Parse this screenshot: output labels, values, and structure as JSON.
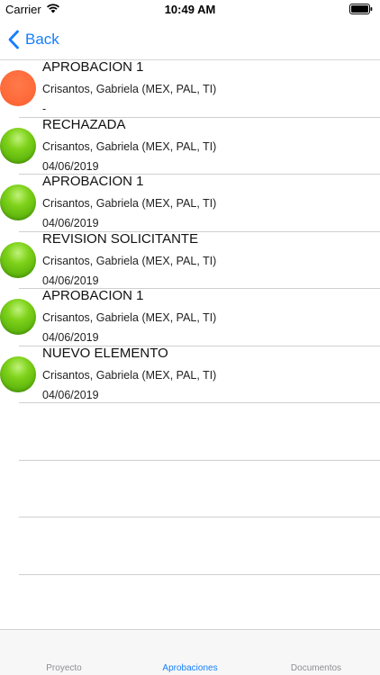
{
  "status_bar": {
    "carrier": "Carrier",
    "time": "10:49 AM"
  },
  "nav": {
    "back_label": "Back"
  },
  "approvals": [
    {
      "title": "APROBACION 1",
      "person": "Crisantos, Gabriela (MEX, PAL, TI)",
      "date": "-",
      "status_color": "#ff6a3a"
    },
    {
      "title": "RECHAZADA",
      "person": "Crisantos, Gabriela (MEX, PAL, TI)",
      "date": "04/06/2019",
      "status_color": "#6cc514"
    },
    {
      "title": "APROBACION 1",
      "person": "Crisantos, Gabriela (MEX, PAL, TI)",
      "date": "04/06/2019",
      "status_color": "#6cc514"
    },
    {
      "title": "REVISION SOLICITANTE",
      "person": "Crisantos, Gabriela (MEX, PAL, TI)",
      "date": "04/06/2019",
      "status_color": "#6cc514"
    },
    {
      "title": "APROBACION 1",
      "person": "Crisantos, Gabriela (MEX, PAL, TI)",
      "date": "04/06/2019",
      "status_color": "#6cc514"
    },
    {
      "title": "NUEVO ELEMENTO",
      "person": "Crisantos, Gabriela (MEX, PAL, TI)",
      "date": "04/06/2019",
      "status_color": "#6cc514"
    }
  ],
  "tabs": [
    {
      "label": "Proyecto",
      "active": false
    },
    {
      "label": "Aprobaciones",
      "active": true
    },
    {
      "label": "Documentos",
      "active": false
    }
  ],
  "colors": {
    "accent": "#157efb",
    "inactive_tab": "#8e8e93",
    "separator": "#cfcfcf"
  }
}
